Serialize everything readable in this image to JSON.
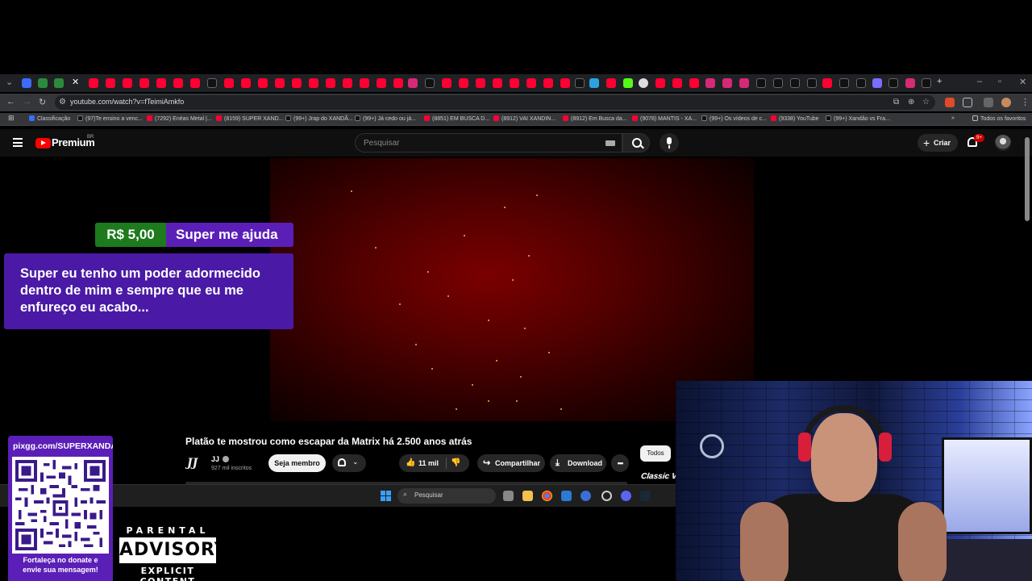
{
  "browser": {
    "url": "youtube.com/watch?v=fTeimiAmkfo",
    "all_bookmarks_label": "Todos os favoritos",
    "bookmarks": [
      {
        "label": "Classificação",
        "color": "#3b6bff"
      },
      {
        "label": "(97)Te ensino a venc...",
        "color": "#111111"
      },
      {
        "label": "(7292) Enéas Metal |...",
        "color": "#ff0033"
      },
      {
        "label": "(8159) SUPER XAND...",
        "color": "#ff0033"
      },
      {
        "label": "(99+) Jrap do XANDÃ...",
        "color": "#111111"
      },
      {
        "label": "(99+) Já cedo ou já...",
        "color": "#111111"
      },
      {
        "label": "(8851) EM BUSCA D...",
        "color": "#ff0033"
      },
      {
        "label": "(8912) VAI XANDIN...",
        "color": "#ff0033"
      },
      {
        "label": "(8912) Em Busca da...",
        "color": "#ff0033"
      },
      {
        "label": "(9078) MANTIS - XA...",
        "color": "#ff0033"
      },
      {
        "label": "(99+) Os vídeos de c...",
        "color": "#111111"
      },
      {
        "label": "(9338) YouTube",
        "color": "#ff0033"
      },
      {
        "label": "(99+) Xandão vs Fra...",
        "color": "#111111"
      }
    ]
  },
  "youtube": {
    "logo_text": "Premium",
    "region": "BR",
    "search_placeholder": "Pesquisar",
    "create_label": "Criar",
    "notification_count": "9+"
  },
  "superchat": {
    "amount": "R$ 5,00",
    "name": "Super me ajuda",
    "message": "Super eu tenho um poder adormecido dentro de mim e sempre que eu me enfureço eu acabo..."
  },
  "video": {
    "title": "Platão te mostrou como escapar da Matrix há 2.500 anos atrás",
    "channel_logo": "JJ",
    "channel": "JJ",
    "subscribers": "927 mil inscritos",
    "join_label": "Seja membro",
    "likes": "11 mil",
    "share_label": "Compartilhar",
    "download_label": "Download",
    "more_label": "•••",
    "chip_all": "Todos",
    "side_label": "Classic Vi"
  },
  "taskbar": {
    "search_placeholder": "Pesquisar"
  },
  "donation": {
    "url": "pixgg.com/SUPERXANDAO",
    "caption_line1": "Fortaleça no donate e",
    "caption_line2": "envie sua mensagem!"
  },
  "parental_advisory": {
    "top": "PARENTAL",
    "middle": "ADVISORY",
    "bottom": "EXPLICIT CONTENT"
  },
  "colors": {
    "youtube_red": "#ff0000",
    "superchat_purple": "#5b1fb8",
    "superchat_green": "#1d7a1d"
  }
}
